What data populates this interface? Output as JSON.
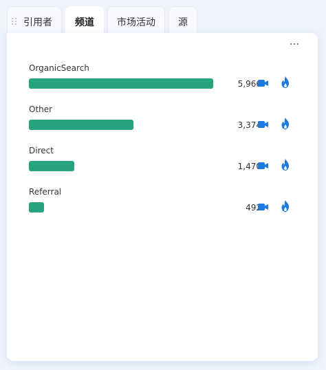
{
  "tabs": [
    {
      "label": "引用者",
      "active": false
    },
    {
      "label": "频道",
      "active": true
    },
    {
      "label": "市场活动",
      "active": false
    },
    {
      "label": "源",
      "active": false
    }
  ],
  "colors": {
    "bar": "#27a37f",
    "icon": "#1f7ae0"
  },
  "channels": [
    {
      "label": "OrganicSearch",
      "value": 5966,
      "value_text": "5,966"
    },
    {
      "label": "Other",
      "value": 3374,
      "value_text": "3,374"
    },
    {
      "label": "Direct",
      "value": 1470,
      "value_text": "1,470"
    },
    {
      "label": "Referral",
      "value": 492,
      "value_text": "492"
    }
  ],
  "icons": {
    "more": "more-horizontal-icon",
    "video": "video-camera-icon",
    "fire": "fire-icon",
    "drag": "drag-handle-icon"
  }
}
